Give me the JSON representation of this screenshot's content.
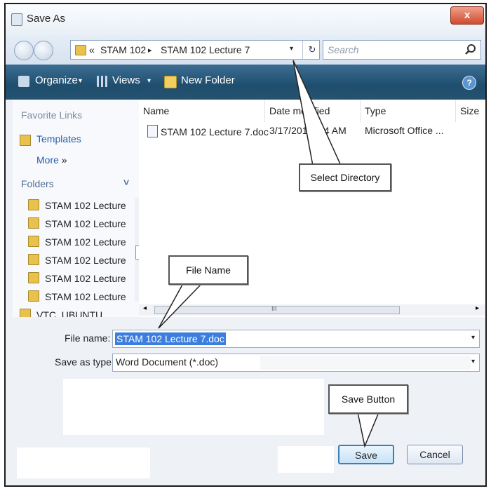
{
  "window": {
    "title": "Save As",
    "close_label": "x"
  },
  "address": {
    "prefix": "«",
    "crumbs": [
      "STAM 102",
      "STAM 102 Lecture 7"
    ],
    "separator": "▸",
    "dropdown": "▾",
    "refresh": "↻"
  },
  "search": {
    "placeholder": "Search"
  },
  "toolbar": {
    "organize": "Organize",
    "views": "Views",
    "new_folder": "New Folder",
    "help": "?"
  },
  "favorites": {
    "header": "Favorite Links",
    "items": [
      "Templates",
      "More"
    ],
    "more_arrow": "»"
  },
  "folders": {
    "header": "Folders",
    "chevron": "˅",
    "items": [
      "STAM 102 Lecture",
      "STAM 102 Lecture",
      "STAM 102 Lecture",
      "STAM 102 Lecture",
      "STAM 102 Lecture",
      "STAM 102 Lecture",
      "VTC_UBUNTU"
    ]
  },
  "files": {
    "columns": [
      "Name",
      "Date modified",
      "Type",
      "Size"
    ],
    "rows": [
      {
        "name": "STAM 102 Lecture 7.doc",
        "date": "3/17/2010 ...4 AM",
        "type": "Microsoft Office ..."
      }
    ],
    "scroll_grip": "III"
  },
  "form": {
    "file_name_label": "File name:",
    "file_name_value": "STAM 102 Lecture 7.doc",
    "save_type_label": "Save as type:",
    "save_type_value": "Word Document (*.doc)",
    "dropdown": "▾"
  },
  "buttons": {
    "save": "Save",
    "cancel": "Cancel"
  },
  "callouts": {
    "select_directory": "Select Directory",
    "file_name": "File Name",
    "save_button": "Save Button"
  }
}
